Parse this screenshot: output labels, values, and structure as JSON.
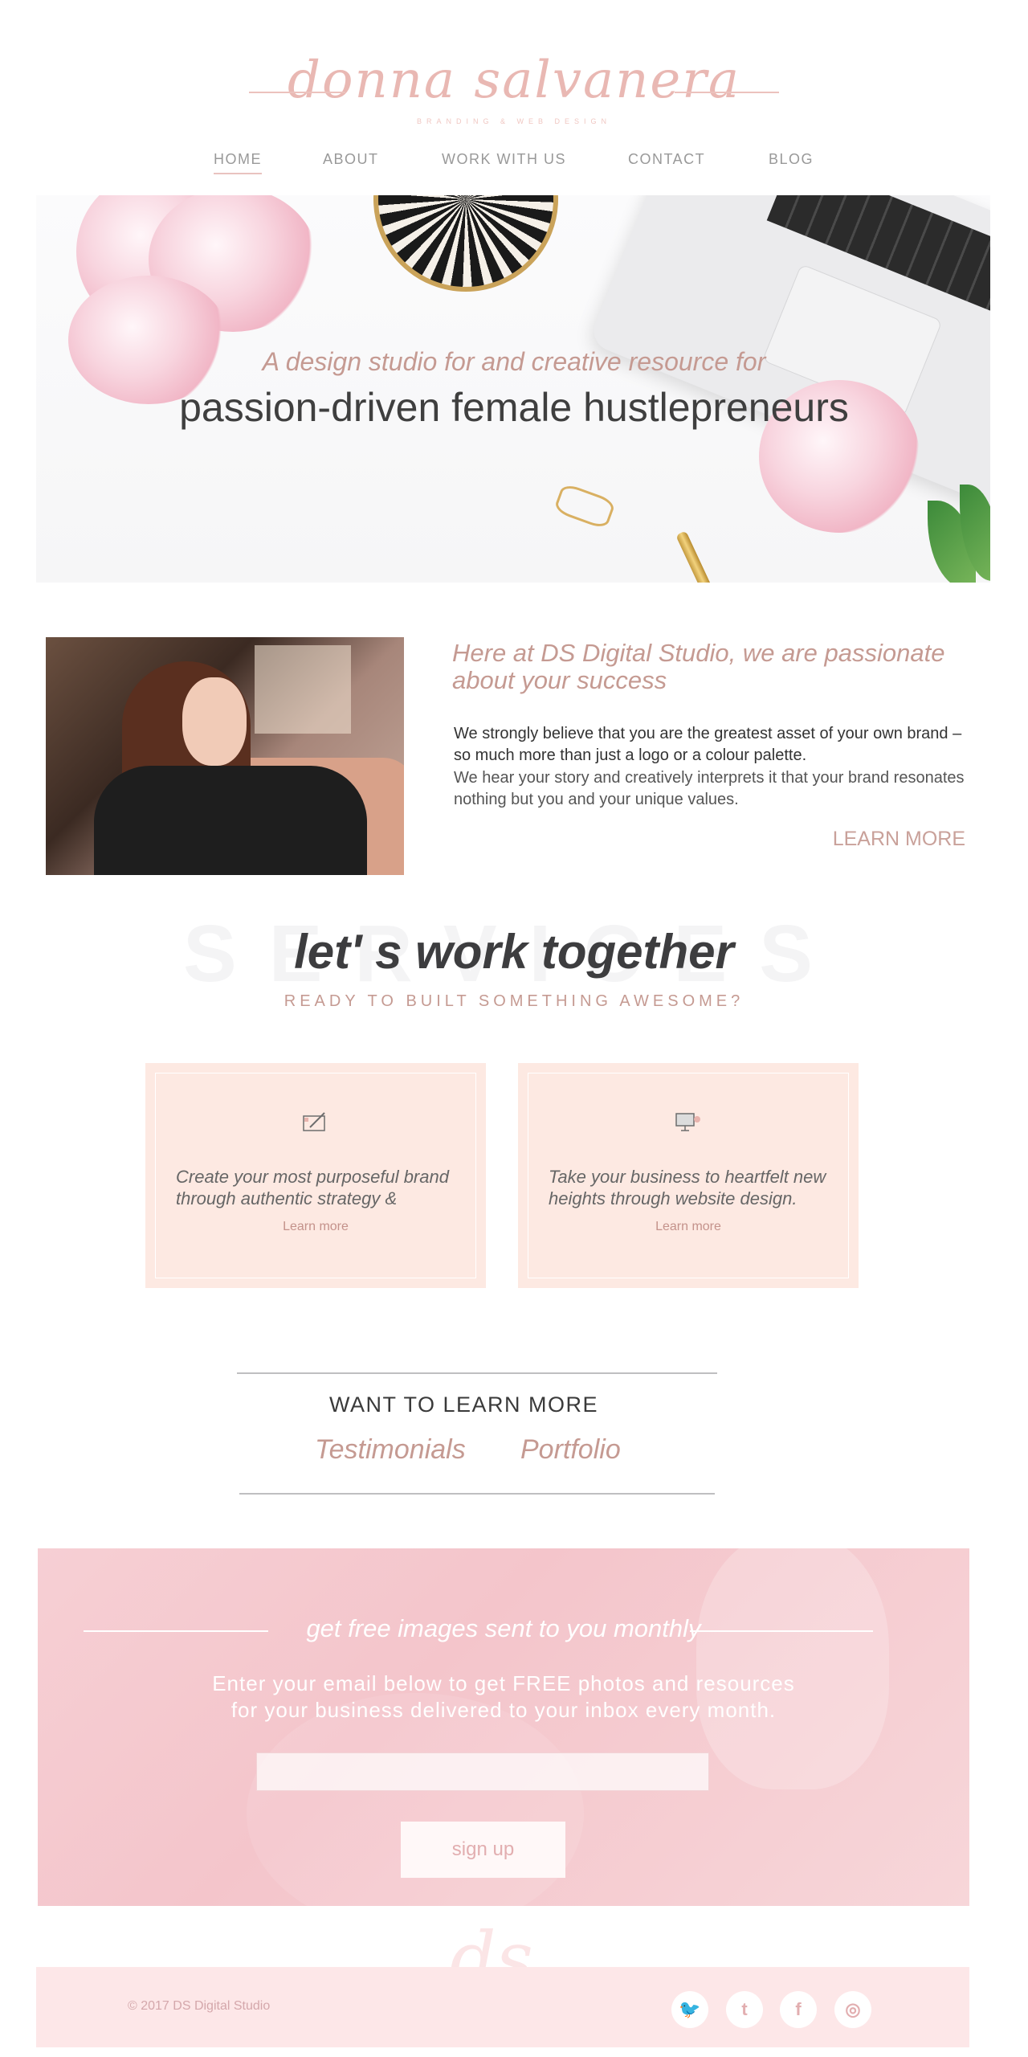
{
  "brand": {
    "name": "donna salvanera",
    "subtitle": "BRANDING & WEB DESIGN"
  },
  "nav": {
    "items": [
      {
        "label": "HOME",
        "active": true
      },
      {
        "label": "ABOUT"
      },
      {
        "label": "WORK WITH US"
      },
      {
        "label": "CONTACT"
      },
      {
        "label": "BLOG"
      }
    ]
  },
  "hero": {
    "tagline": "A design studio for and creative resource for",
    "heading": "passion-driven female hustlepreneurs"
  },
  "about": {
    "heading": "Here at DS Digital Studio, we are passionate about your success",
    "paragraph1": "We strongly believe that you are the greatest asset of your own brand – so much more than just a logo or a colour palette.",
    "paragraph2": " We hear your story and creatively interprets it that your brand resonates nothing but you and your unique values.",
    "learn_more": "LEARN MORE"
  },
  "services": {
    "background_word": "SERVICES",
    "title": "let' s work together",
    "subtitle": "READY TO BUILT SOMETHING AWESOME?",
    "cards": [
      {
        "icon": "pencil-notepad-icon",
        "text": "Create your most purposeful brand through authentic strategy &",
        "link": "Learn more"
      },
      {
        "icon": "monitor-design-icon",
        "text": "Take your business to heartfelt new heights through website design.",
        "link": "Learn more"
      }
    ]
  },
  "learn": {
    "title": "WANT TO LEARN MORE",
    "links": [
      "Testimonials",
      "Portfolio"
    ]
  },
  "newsletter": {
    "title": "get free images sent to you monthly",
    "text_line1": "Enter your email below to get FREE photos and resources",
    "text_line2": "for your business delivered to your inbox every month.",
    "input_placeholder": "",
    "button": "sign up"
  },
  "footer": {
    "mark": "ds",
    "copyright": "© 2017 DS Digital Studio",
    "social": [
      {
        "icon": "twitter-icon",
        "glyph": "🐦"
      },
      {
        "icon": "tumblr-icon",
        "glyph": "t"
      },
      {
        "icon": "facebook-icon",
        "glyph": "f"
      },
      {
        "icon": "instagram-icon",
        "glyph": "◎"
      }
    ]
  },
  "colors": {
    "accent": "#c59a92",
    "pink_light": "#fde9e2",
    "pink_band": "#f6cfd4",
    "text_dark": "#3f3f3f"
  }
}
